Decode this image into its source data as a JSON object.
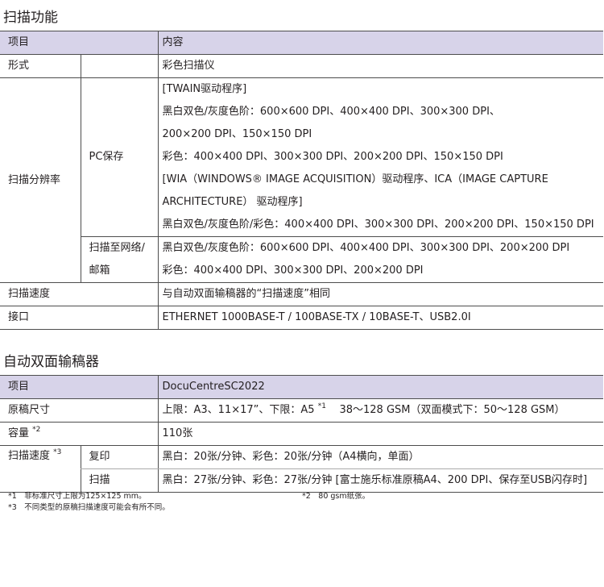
{
  "scan": {
    "title": "扫描功能",
    "head": {
      "item": "项目",
      "content": "内容"
    },
    "form": {
      "label": "形式",
      "value": "彩色扫描仪"
    },
    "resolution": {
      "label": "扫描分辨率",
      "pc": {
        "label": "PC保存",
        "lines": [
          "[TWAIN驱动程序]",
          "黑白双色/灰度色阶：600×600 DPI、400×400 DPI、300×300 DPI、",
          "200×200 DPI、150×150 DPI",
          "彩色：400×400 DPI、300×300 DPI、200×200 DPI、150×150 DPI",
          "[WIA（WINDOWS® IMAGE ACQUISITION）驱动程序、ICA（IMAGE CAPTURE",
          "ARCHITECTURE） 驱动程序]",
          "黑白双色/灰度色阶/彩色：400×400 DPI、300×300 DPI、200×200 DPI、150×150 DPI"
        ]
      },
      "network": {
        "label_line1": "扫描至网络/",
        "label_line2": "邮箱",
        "lines": [
          "黑白双色/灰度色阶：600×600 DPI、400×400 DPI、300×300 DPI、200×200 DPI",
          "彩色：400×400 DPI、300×300 DPI、200×200 DPI"
        ]
      }
    },
    "speed": {
      "label": "扫描速度",
      "value": "与自动双面输稿器的“扫描速度”相同"
    },
    "interface": {
      "label": "接口",
      "value": "ETHERNET 1000BASE-T / 100BASE-TX / 10BASE-T、USB2.0I"
    }
  },
  "adf": {
    "title": "自动双面输稿器",
    "head": {
      "item": "项目",
      "content": "DocuCentreSC2022"
    },
    "size": {
      "label": "原稿尺寸",
      "value_main": "上限：A3、11×17”、下限：A5",
      "sup": "*1",
      "value_rest": "38～128 GSM（双面模式下：50～128 GSM）"
    },
    "capacity": {
      "label": "容量",
      "sup": "*2",
      "value": "110张"
    },
    "speed": {
      "label": "扫描速度",
      "sup": "*3",
      "copy": {
        "label": "复印",
        "value": "黑白：20张/分钟、彩色：20张/分钟（A4横向，单面）"
      },
      "scan": {
        "label": "扫描",
        "value": "黑白：27张/分钟、彩色：27张/分钟 [富士施乐标准原稿A4、200 DPI、保存至USB闪存时]"
      }
    }
  },
  "notes": {
    "n1": "*1　非标准尺寸上限为125×125 mm。",
    "n2": "*2　80 gsm纸张。",
    "n3": "*3　不同类型的原稿扫描速度可能会有所不同。"
  }
}
